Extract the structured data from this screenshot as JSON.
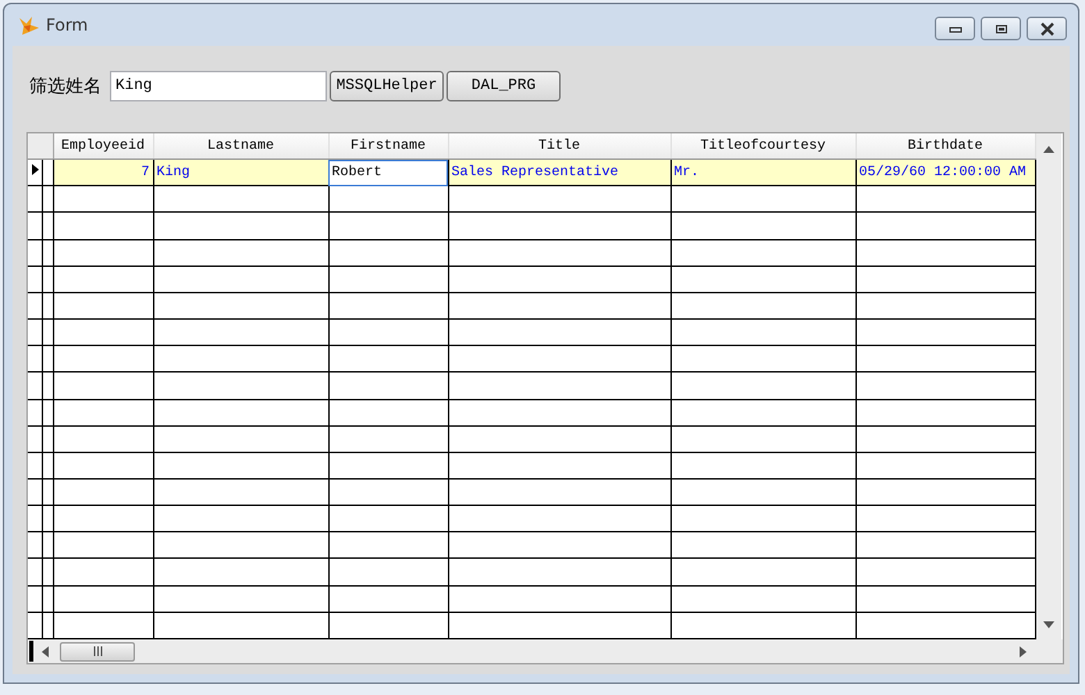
{
  "window": {
    "title": "Form"
  },
  "filter": {
    "label": "筛选姓名",
    "value": "King"
  },
  "buttons": [
    "MSSQLHelper",
    "DAL_PRG"
  ],
  "table": {
    "columns": [
      {
        "label": "Employeeid",
        "kind": "number"
      },
      {
        "label": "Lastname",
        "kind": "text"
      },
      {
        "label": "Firstname",
        "kind": "text"
      },
      {
        "label": "Title",
        "kind": "text"
      },
      {
        "label": "Titleofcourtesy",
        "kind": "text"
      },
      {
        "label": "Birthdate",
        "kind": "text"
      }
    ],
    "rows": [
      {
        "selected": true,
        "cells": [
          {
            "text": "7",
            "focused": false
          },
          {
            "text": "King",
            "focused": false
          },
          {
            "text": "Robert",
            "focused": true
          },
          {
            "text": "Sales Representative",
            "focused": false
          },
          {
            "text": "Mr.",
            "focused": false
          },
          {
            "text": "05/29/60 12:00:00 AM",
            "focused": false
          }
        ]
      }
    ]
  }
}
